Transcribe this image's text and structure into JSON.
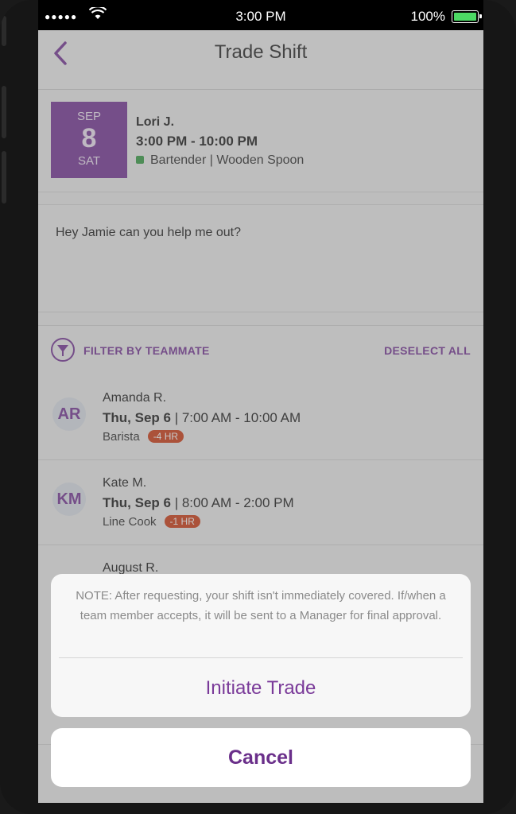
{
  "status_bar": {
    "signal": "●●●●●",
    "wifi_icon": "wifi-icon",
    "time": "3:00 PM",
    "battery": "100%"
  },
  "nav": {
    "back_icon": "chevron-left-icon",
    "title": "Trade Shift"
  },
  "shift": {
    "month": "SEP",
    "day": "8",
    "weekday": "SAT",
    "name": "Lori J.",
    "time": "3:00 PM - 10:00 PM",
    "role": "Bartender | Wooden Spoon",
    "role_color": "#3aa14a"
  },
  "message": "Hey Jamie can you help me out?",
  "filter": {
    "icon": "filter-icon",
    "label": "FILTER BY TEAMMATE",
    "deselect_label": "DESELECT ALL"
  },
  "teammates": [
    {
      "initials": "AR",
      "name": "Amanda R.",
      "day": "Thu, Sep 6",
      "time": " | 7:00 AM - 10:00 AM",
      "role": "Barista",
      "badge": "-4 HR"
    },
    {
      "initials": "KM",
      "name": "Kate M.",
      "day": "Thu, Sep 6",
      "time": " | 8:00 AM - 2:00 PM",
      "role": "Line Cook",
      "badge": "-1 HR"
    },
    {
      "initials": "",
      "name": "August R.",
      "day": "",
      "time": "",
      "role": "",
      "badge": ""
    }
  ],
  "action_sheet": {
    "note": "NOTE: After requesting, your shift isn't immediately covered. If/when a team member accepts, it will be sent to a Manager for final approval.",
    "initiate_label": "Initiate Trade",
    "cancel_label": "Cancel"
  },
  "colors": {
    "accent": "#7a3a99",
    "badge": "#d0421b"
  }
}
